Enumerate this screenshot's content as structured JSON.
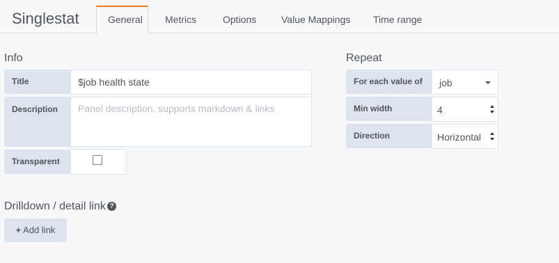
{
  "header": {
    "title": "Singlestat",
    "tabs": [
      {
        "label": "General",
        "active": true
      },
      {
        "label": "Metrics"
      },
      {
        "label": "Options"
      },
      {
        "label": "Value Mappings"
      },
      {
        "label": "Time range"
      }
    ]
  },
  "info": {
    "heading": "Info",
    "title_label": "Title",
    "title_value": "$job health state",
    "description_label": "Description",
    "description_placeholder": "Panel description, supports markdown & links",
    "transparent_label": "Transparent",
    "transparent_checked": false
  },
  "repeat": {
    "heading": "Repeat",
    "for_each_label": "For each value of",
    "for_each_value": "job",
    "min_width_label": "Min width",
    "min_width_value": "4",
    "direction_label": "Direction",
    "direction_value": "Horizontal"
  },
  "drilldown": {
    "heading": "Drilldown / detail link",
    "help_icon": "question-circle-icon",
    "add_link_label": "Add link"
  },
  "colors": {
    "accent": "#eb7b18",
    "label_bg": "#dde4ed",
    "page_bg": "#f7f8fa"
  }
}
